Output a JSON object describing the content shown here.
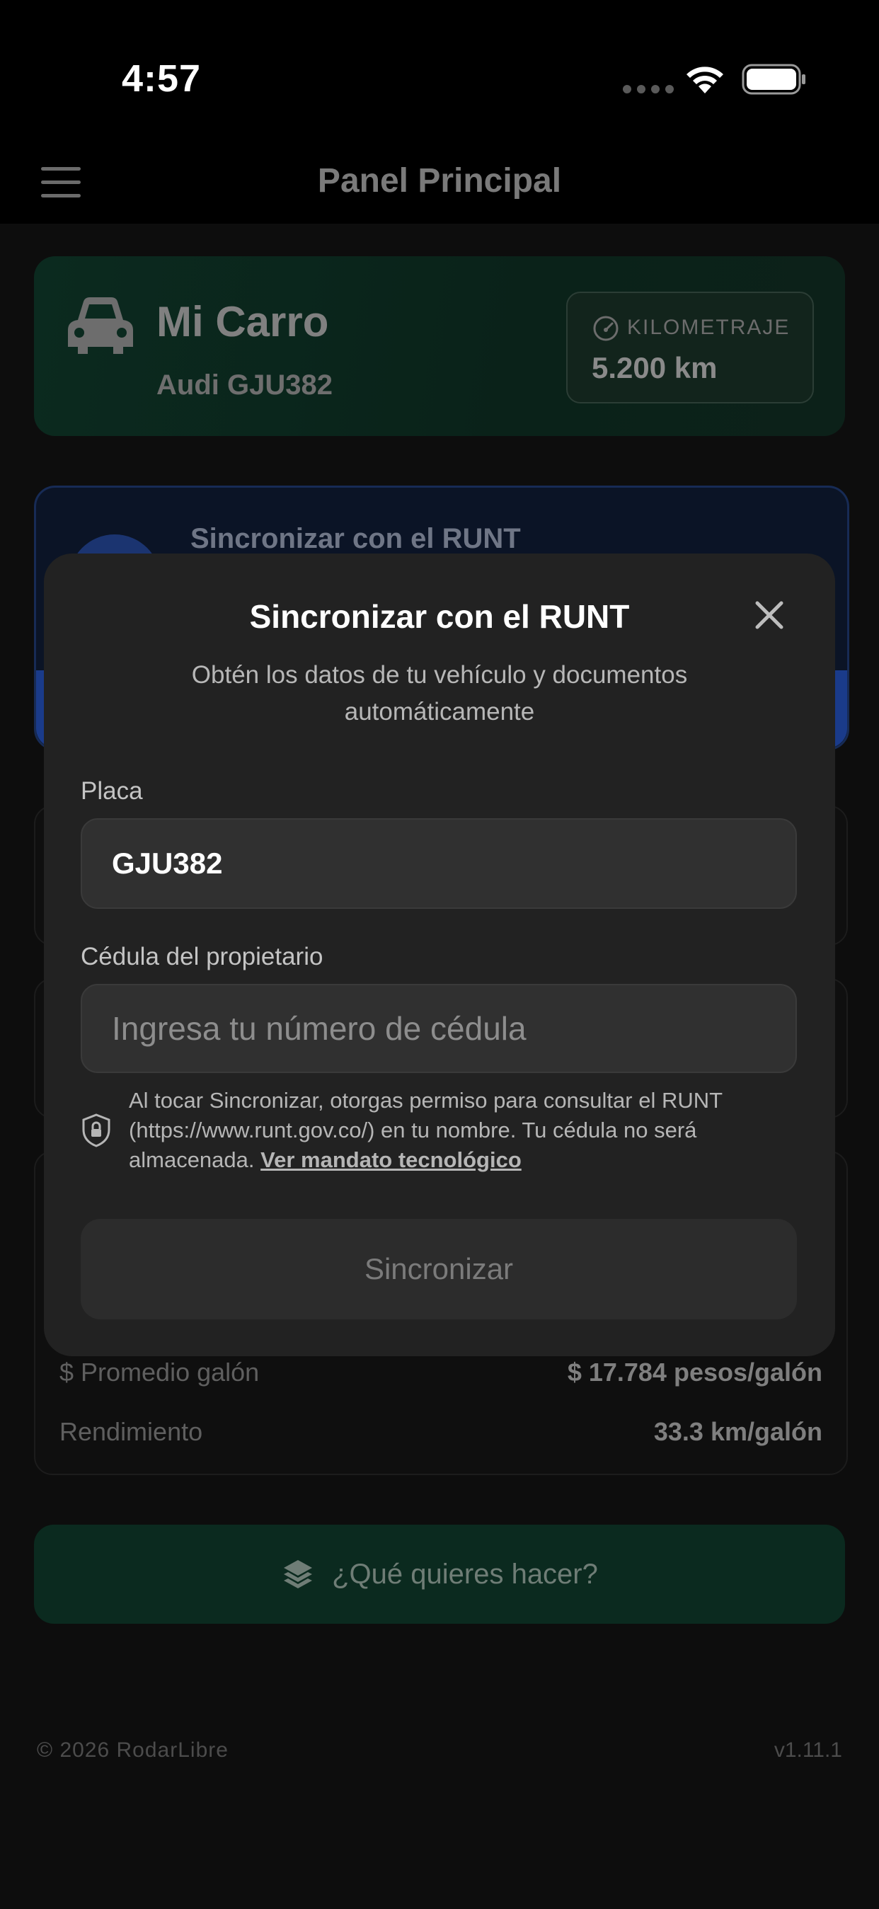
{
  "status_bar": {
    "time": "4:57"
  },
  "header": {
    "title": "Panel Principal"
  },
  "car_card": {
    "title": "Mi Carro",
    "subtitle": "Audi GJU382",
    "km_label": "KILOMETRAJE",
    "km_value": "5.200 km"
  },
  "sync_card": {
    "title": "Sincronizar con el RUNT"
  },
  "stats": [
    {
      "label": "$ Promedio galón",
      "value": "$ 17.784 pesos/galón"
    },
    {
      "label": "Rendimiento",
      "value": "33.3 km/galón"
    }
  ],
  "action_button": {
    "label": "¿Qué quieres hacer?"
  },
  "footer": {
    "copyright": "© 2026 RodarLibre",
    "version": "v1.11.1"
  },
  "modal": {
    "title": "Sincronizar con el RUNT",
    "subtitle": "Obtén los datos de tu vehículo y documentos automáticamente",
    "plate_label": "Placa",
    "plate_value": "GJU382",
    "id_label": "Cédula del propietario",
    "id_placeholder": "Ingresa tu número de cédula",
    "consent_text": "Al tocar Sincronizar, otorgas permiso para consultar el RUNT (https://www.runt.gov.co/) en tu nombre. Tu cédula no será almacenada.",
    "consent_link": "Ver mandato tecnológico",
    "submit_label": "Sincronizar"
  }
}
